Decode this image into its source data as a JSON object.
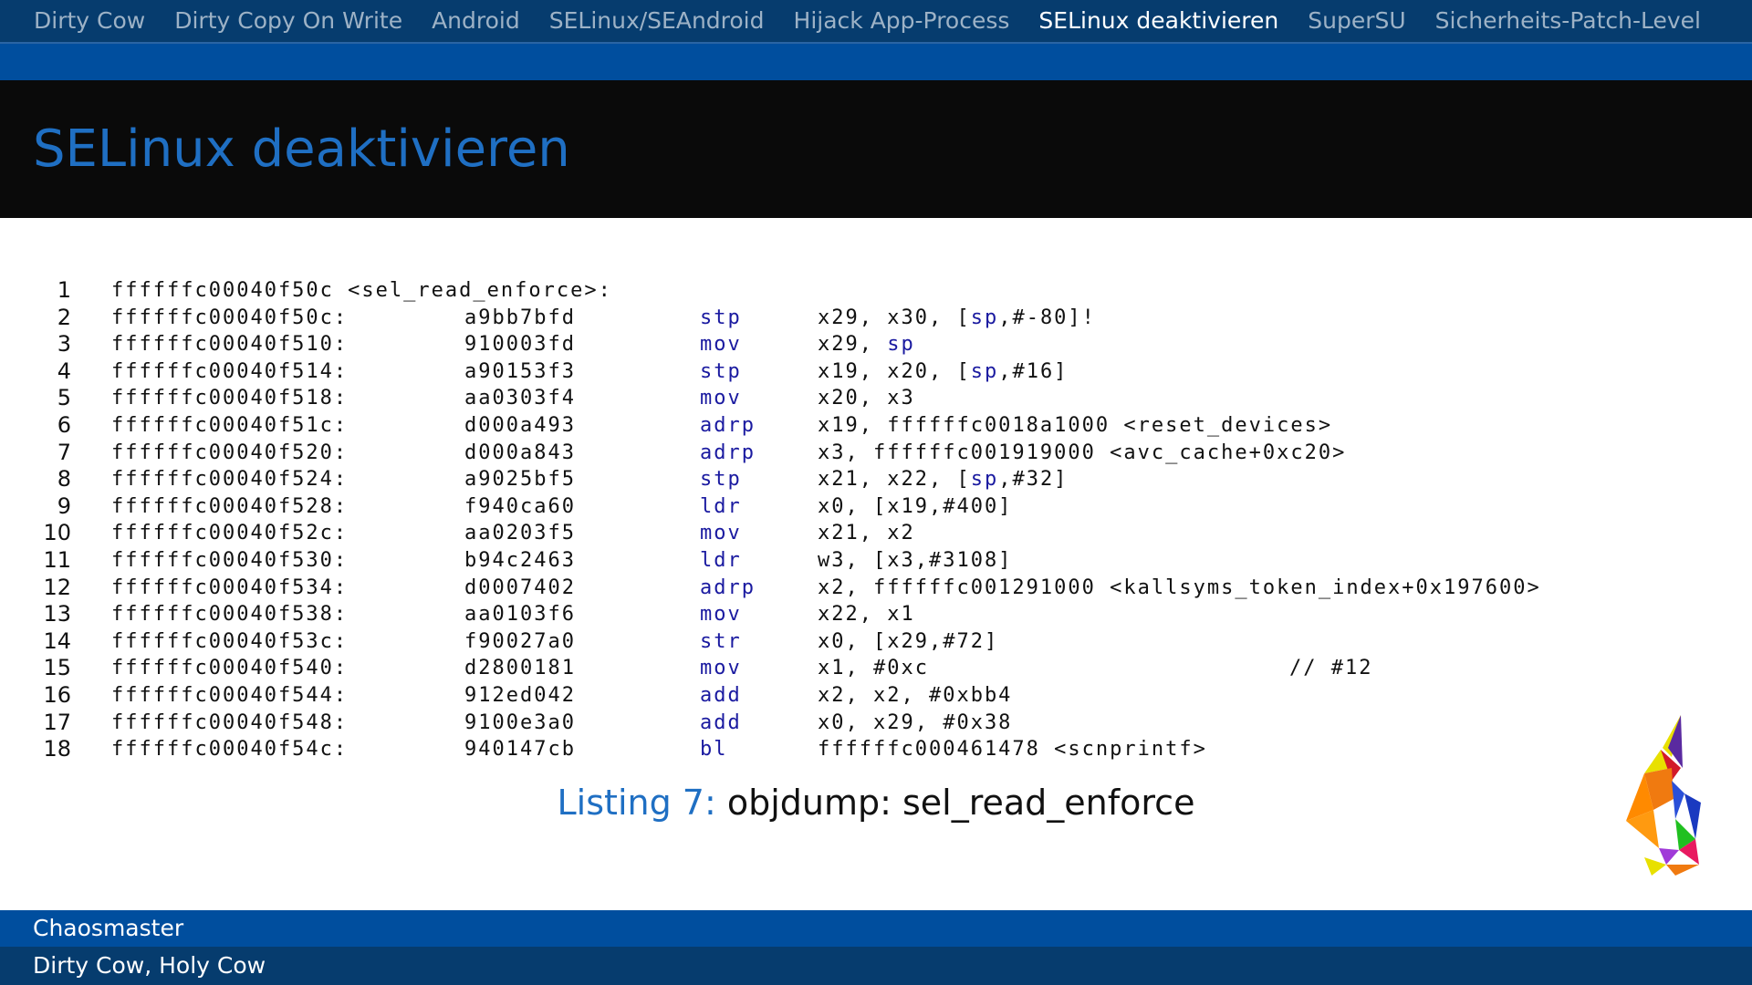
{
  "nav": {
    "items": [
      {
        "label": "Dirty Cow",
        "active": false
      },
      {
        "label": "Dirty Copy On Write",
        "active": false
      },
      {
        "label": "Android",
        "active": false
      },
      {
        "label": "SELinux/SEAndroid",
        "active": false
      },
      {
        "label": "Hijack App-Process",
        "active": false
      },
      {
        "label": "SELinux deaktivieren",
        "active": true
      },
      {
        "label": "SuperSU",
        "active": false
      },
      {
        "label": "Sicherheits-Patch-Level",
        "active": false
      }
    ]
  },
  "frame": {
    "title": "SELinux deaktivieren"
  },
  "listing": {
    "header_line_number": "1",
    "header": "ffffffc00040f50c <sel_read_enforce>:",
    "rows": [
      {
        "n": "2",
        "addr": "ffffffc00040f50c:",
        "opcode": "a9bb7bfd",
        "mnemonic": "stp",
        "operands": [
          {
            "t": "x29, x30, ["
          },
          {
            "t": "sp",
            "kw": true
          },
          {
            "t": ",#-80]!"
          }
        ],
        "comment": ""
      },
      {
        "n": "3",
        "addr": "ffffffc00040f510:",
        "opcode": "910003fd",
        "mnemonic": "mov",
        "operands": [
          {
            "t": "x29, "
          },
          {
            "t": "sp",
            "kw": true
          }
        ],
        "comment": ""
      },
      {
        "n": "4",
        "addr": "ffffffc00040f514:",
        "opcode": "a90153f3",
        "mnemonic": "stp",
        "operands": [
          {
            "t": "x19, x20, ["
          },
          {
            "t": "sp",
            "kw": true
          },
          {
            "t": ",#16]"
          }
        ],
        "comment": ""
      },
      {
        "n": "5",
        "addr": "ffffffc00040f518:",
        "opcode": "aa0303f4",
        "mnemonic": "mov",
        "operands": [
          {
            "t": "x20, x3"
          }
        ],
        "comment": ""
      },
      {
        "n": "6",
        "addr": "ffffffc00040f51c:",
        "opcode": "d000a493",
        "mnemonic": "adrp",
        "operands": [
          {
            "t": "x19, ffffffc0018a1000 <reset_devices>"
          }
        ],
        "comment": ""
      },
      {
        "n": "7",
        "addr": "ffffffc00040f520:",
        "opcode": "d000a843",
        "mnemonic": "adrp",
        "operands": [
          {
            "t": "x3, ffffffc001919000 <avc_cache+0xc20>"
          }
        ],
        "comment": ""
      },
      {
        "n": "8",
        "addr": "ffffffc00040f524:",
        "opcode": "a9025bf5",
        "mnemonic": "stp",
        "operands": [
          {
            "t": "x21, x22, ["
          },
          {
            "t": "sp",
            "kw": true
          },
          {
            "t": ",#32]"
          }
        ],
        "comment": ""
      },
      {
        "n": "9",
        "addr": "ffffffc00040f528:",
        "opcode": "f940ca60",
        "mnemonic": "ldr",
        "operands": [
          {
            "t": "x0, [x19,#400]"
          }
        ],
        "comment": ""
      },
      {
        "n": "10",
        "addr": "ffffffc00040f52c:",
        "opcode": "aa0203f5",
        "mnemonic": "mov",
        "operands": [
          {
            "t": "x21, x2"
          }
        ],
        "comment": ""
      },
      {
        "n": "11",
        "addr": "ffffffc00040f530:",
        "opcode": "b94c2463",
        "mnemonic": "ldr",
        "operands": [
          {
            "t": "w3, [x3,#3108]"
          }
        ],
        "comment": ""
      },
      {
        "n": "12",
        "addr": "ffffffc00040f534:",
        "opcode": "d0007402",
        "mnemonic": "adrp",
        "operands": [
          {
            "t": "x2, ffffffc001291000 <kallsyms_token_index+0x197600>"
          }
        ],
        "comment": ""
      },
      {
        "n": "13",
        "addr": "ffffffc00040f538:",
        "opcode": "aa0103f6",
        "mnemonic": "mov",
        "operands": [
          {
            "t": "x22, x1"
          }
        ],
        "comment": ""
      },
      {
        "n": "14",
        "addr": "ffffffc00040f53c:",
        "opcode": "f90027a0",
        "mnemonic": "str",
        "operands": [
          {
            "t": "x0, [x29,#72]"
          }
        ],
        "comment": ""
      },
      {
        "n": "15",
        "addr": "ffffffc00040f540:",
        "opcode": "d2800181",
        "mnemonic": "mov",
        "operands": [
          {
            "t": "x1, #0xc"
          }
        ],
        "comment": "// #12"
      },
      {
        "n": "16",
        "addr": "ffffffc00040f544:",
        "opcode": "912ed042",
        "mnemonic": "add",
        "operands": [
          {
            "t": "x2, x2, #0xbb4"
          }
        ],
        "comment": ""
      },
      {
        "n": "17",
        "addr": "ffffffc00040f548:",
        "opcode": "9100e3a0",
        "mnemonic": "add",
        "operands": [
          {
            "t": "x0, x29, #0x38"
          }
        ],
        "comment": ""
      },
      {
        "n": "18",
        "addr": "ffffffc00040f54c:",
        "opcode": "940147cb",
        "mnemonic": "bl",
        "operands": [
          {
            "t": "ffffffc000461478 <scnprintf>"
          }
        ],
        "comment": ""
      }
    ]
  },
  "caption": {
    "label": "Listing 7:",
    "text": " objdump: sel_read_enforce"
  },
  "footer": {
    "author": "Chaosmaster",
    "talk": "Dirty Cow, Holy Cow"
  },
  "colors": {
    "nav_bg": "#063c6e",
    "band_blue": "#004e9e",
    "title_bg": "#0a0a0a",
    "title_fg": "#1f6fc3",
    "keyword": "#1a1aa0"
  },
  "logo": {
    "icon": "origami-rabbit-logo"
  }
}
